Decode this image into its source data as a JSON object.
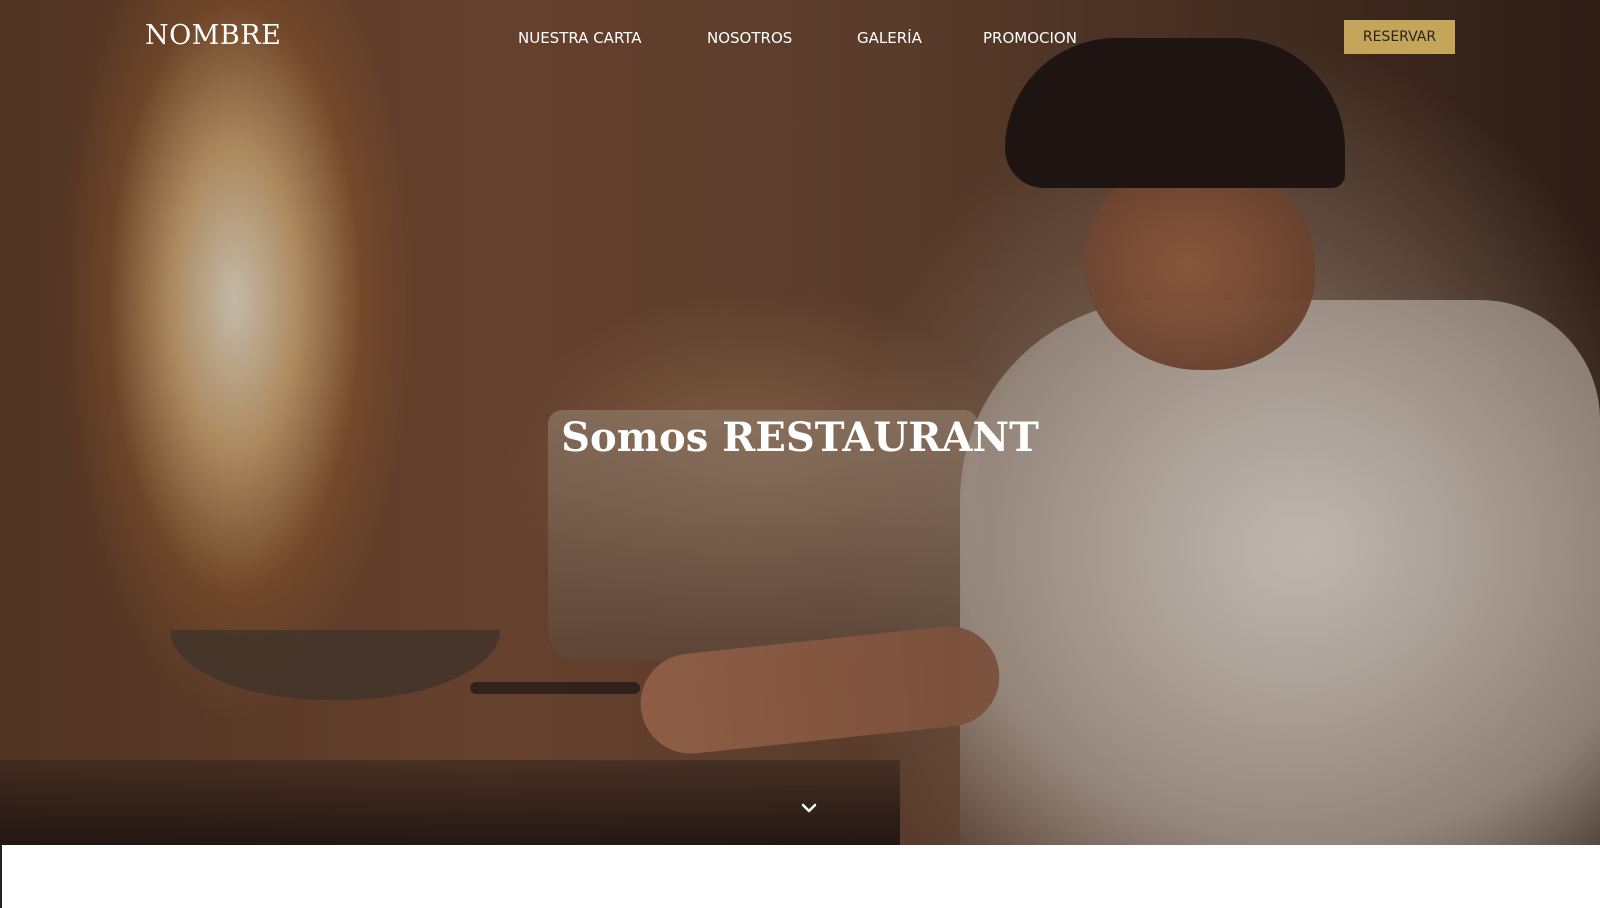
{
  "brand": {
    "name": "NOMBRE"
  },
  "nav": {
    "items": [
      {
        "label": "NUESTRA CARTA"
      },
      {
        "label": "NOSOTROS"
      },
      {
        "label": "GALERÍA"
      },
      {
        "label": "PROMOCION"
      }
    ],
    "cta_label": "RESERVAR"
  },
  "hero": {
    "title": "Somos RESTAURANT",
    "background_image": "chef-flambe-kitchen-photo",
    "scroll_icon": "chevron-down-icon"
  },
  "colors": {
    "accent": "#c4a55a",
    "text_light": "#ffffff",
    "cta_text": "#2b2418",
    "page_bg": "#ffffff"
  }
}
